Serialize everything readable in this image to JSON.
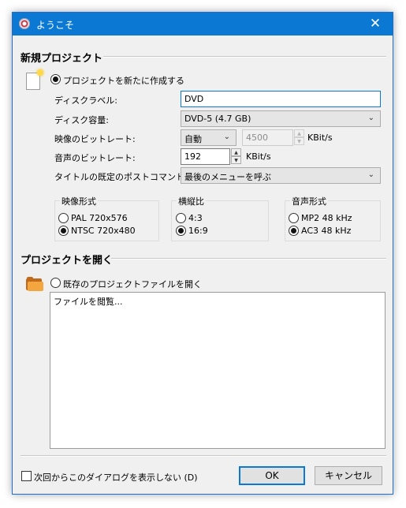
{
  "window": {
    "title": "ようこそ",
    "close_glyph": "✕"
  },
  "new_project": {
    "heading": "新規プロジェクト",
    "create_radio_label": "プロジェクトを新たに作成する",
    "disc_label_label": "ディスクラベル:",
    "disc_label_value": "DVD",
    "disc_capacity_label": "ディスク容量:",
    "disc_capacity_value": "DVD-5 (4.7 GB)",
    "video_bitrate_label": "映像のビットレート:",
    "video_bitrate_mode": "自動",
    "video_bitrate_value": "4500",
    "video_bitrate_unit": "KBit/s",
    "audio_bitrate_label": "音声のビットレート:",
    "audio_bitrate_value": "192",
    "audio_bitrate_unit": "KBit/s",
    "post_command_label": "タイトルの既定のポストコマンド:",
    "post_command_value": "最後のメニューを呼ぶ",
    "video_format": {
      "title": "映像形式",
      "options": [
        "PAL 720x576",
        "NTSC 720x480"
      ],
      "selected": "NTSC 720x480"
    },
    "aspect_ratio": {
      "title": "横縦比",
      "options": [
        "4:3",
        "16:9"
      ],
      "selected": "16:9"
    },
    "audio_format": {
      "title": "音声形式",
      "options": [
        "MP2 48 kHz",
        "AC3 48 kHz"
      ],
      "selected": "AC3 48 kHz"
    }
  },
  "open_project": {
    "heading": "プロジェクトを開く",
    "open_radio_label": "既存のプロジェクトファイルを開く",
    "file_list_item": "ファイルを閲覧..."
  },
  "footer": {
    "dont_show_label": "次回からこのダイアログを表示しない (D)",
    "ok_label": "OK",
    "cancel_label": "キャンセル"
  },
  "icons": {
    "app": "disc-icon",
    "new_doc": "new-document-icon",
    "folder": "folder-icon",
    "chevron": "chevron-down-icon",
    "spin_up": "spin-up-icon",
    "spin_down": "spin-down-icon"
  },
  "colors": {
    "titlebar": "#0b78d4",
    "dialog_bg": "#f0f0f0",
    "accent": "#0b78d4"
  }
}
